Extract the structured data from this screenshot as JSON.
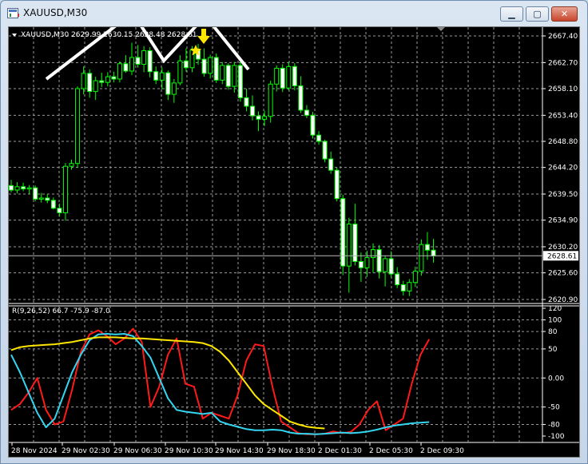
{
  "window": {
    "title": "XAUUSD,M30",
    "min_glyph": "▁",
    "max_glyph": "▢",
    "close_glyph": "✕"
  },
  "price_panel": {
    "info": "XAUUSD,M30  2629.99 2630.15 2628.48 2628.61",
    "current_price": "2628.61",
    "y_ticks": [
      "2667.40",
      "2662.70",
      "2658.10",
      "2653.40",
      "2648.80",
      "2644.20",
      "2639.50",
      "2634.90",
      "2630.20",
      "2625.60",
      "2620.90"
    ]
  },
  "indicator_panel": {
    "label": "R(9,26,52) 66.7 -75.9 -87.0",
    "y_ticks": [
      "120",
      "100",
      "80",
      "50",
      "0.00",
      "-50",
      "-80",
      "-100"
    ]
  },
  "x_axis": {
    "labels": [
      "28 Nov 2024",
      "29 Nov 02:30",
      "29 Nov 06:30",
      "29 Nov 10:30",
      "29 Nov 14:30",
      "29 Nov 18:30",
      "2 Dec 01:30",
      "2 Dec 05:30",
      "2 Dec 09:30"
    ]
  },
  "colors": {
    "background": "#000000",
    "grid": "#9a9a9a",
    "candle": "#00ff00",
    "bull_body": "#000000",
    "bear_body": "#ffffff",
    "red_line": "#ff1a1a",
    "cyan_line": "#33d6f0",
    "yellow_line": "#ffe600",
    "pattern_line": "#ffffff",
    "arrow": "#ffe600"
  },
  "chart_data": [
    {
      "type": "candlestick",
      "symbol": "XAUUSD",
      "timeframe": "M30",
      "ylim": [
        2620.9,
        2667.4
      ],
      "ohlc": [
        [
          2641.0,
          2642.0,
          2639.8,
          2640.2
        ],
        [
          2640.2,
          2641.6,
          2639.6,
          2640.8
        ],
        [
          2640.8,
          2641.5,
          2640.0,
          2640.4
        ],
        [
          2640.4,
          2641.1,
          2639.5,
          2640.6
        ],
        [
          2640.6,
          2641.0,
          2638.2,
          2638.6
        ],
        [
          2638.6,
          2639.7,
          2638.0,
          2638.8
        ],
        [
          2638.8,
          2639.5,
          2637.9,
          2638.4
        ],
        [
          2638.4,
          2638.9,
          2636.8,
          2637.0
        ],
        [
          2637.0,
          2637.8,
          2635.5,
          2636.2
        ],
        [
          2636.2,
          2645.0,
          2634.8,
          2644.4
        ],
        [
          2644.4,
          2645.6,
          2643.8,
          2644.9
        ],
        [
          2644.9,
          2658.5,
          2644.2,
          2658.1
        ],
        [
          2658.1,
          2662.0,
          2657.1,
          2660.8
        ],
        [
          2660.8,
          2661.5,
          2656.5,
          2657.6
        ],
        [
          2657.6,
          2660.2,
          2656.1,
          2659.5
        ],
        [
          2659.5,
          2660.9,
          2658.4,
          2659.2
        ],
        [
          2659.2,
          2661.0,
          2658.5,
          2660.2
        ],
        [
          2660.2,
          2661.1,
          2659.2,
          2659.8
        ],
        [
          2659.8,
          2662.9,
          2659.2,
          2662.5
        ],
        [
          2662.5,
          2664.0,
          2660.9,
          2661.2
        ],
        [
          2661.2,
          2666.2,
          2660.5,
          2663.6
        ],
        [
          2663.6,
          2665.8,
          2661.8,
          2662.4
        ],
        [
          2662.4,
          2665.6,
          2661.0,
          2664.8
        ],
        [
          2664.8,
          2665.4,
          2660.1,
          2661.1
        ],
        [
          2661.1,
          2662.0,
          2658.9,
          2659.6
        ],
        [
          2659.6,
          2661.8,
          2658.0,
          2660.9
        ],
        [
          2660.9,
          2661.3,
          2656.1,
          2657.1
        ],
        [
          2657.1,
          2659.8,
          2655.6,
          2659.1
        ],
        [
          2659.1,
          2664.0,
          2658.7,
          2663.0
        ],
        [
          2663.0,
          2665.2,
          2661.1,
          2661.8
        ],
        [
          2661.8,
          2665.6,
          2661.0,
          2664.9
        ],
        [
          2664.9,
          2666.0,
          2662.3,
          2663.3
        ],
        [
          2663.3,
          2665.2,
          2660.2,
          2660.8
        ],
        [
          2660.8,
          2664.1,
          2659.9,
          2663.6
        ],
        [
          2663.6,
          2664.3,
          2659.1,
          2659.6
        ],
        [
          2659.6,
          2662.8,
          2658.9,
          2662.2
        ],
        [
          2662.2,
          2662.6,
          2657.9,
          2658.5
        ],
        [
          2658.5,
          2662.8,
          2657.4,
          2662.2
        ],
        [
          2662.2,
          2662.8,
          2655.8,
          2656.5
        ],
        [
          2656.5,
          2658.1,
          2654.1,
          2655.0
        ],
        [
          2655.0,
          2656.9,
          2652.5,
          2653.3
        ],
        [
          2653.3,
          2654.1,
          2650.6,
          2652.7
        ],
        [
          2652.7,
          2654.2,
          2651.5,
          2653.2
        ],
        [
          2653.2,
          2659.5,
          2652.1,
          2658.9
        ],
        [
          2658.9,
          2662.2,
          2657.6,
          2661.7
        ],
        [
          2661.7,
          2662.4,
          2657.5,
          2658.2
        ],
        [
          2658.2,
          2662.8,
          2657.8,
          2662.0
        ],
        [
          2662.0,
          2662.6,
          2657.8,
          2658.6
        ],
        [
          2658.6,
          2660.3,
          2653.8,
          2654.3
        ],
        [
          2654.3,
          2655.2,
          2652.9,
          2653.4
        ],
        [
          2653.4,
          2654.0,
          2649.3,
          2649.9
        ],
        [
          2649.9,
          2650.6,
          2648.2,
          2648.8
        ],
        [
          2648.8,
          2649.1,
          2645.1,
          2645.7
        ],
        [
          2645.7,
          2647.0,
          2643.1,
          2643.7
        ],
        [
          2643.7,
          2644.2,
          2638.2,
          2638.7
        ],
        [
          2638.7,
          2639.4,
          2625.2,
          2626.8
        ],
        [
          2626.8,
          2635.3,
          2622.1,
          2634.2
        ],
        [
          2634.2,
          2637.8,
          2626.9,
          2627.6
        ],
        [
          2627.6,
          2629.2,
          2624.0,
          2626.5
        ],
        [
          2626.5,
          2629.5,
          2624.9,
          2628.3
        ],
        [
          2628.3,
          2630.8,
          2625.6,
          2629.7
        ],
        [
          2629.7,
          2630.5,
          2624.6,
          2625.8
        ],
        [
          2625.8,
          2628.6,
          2623.2,
          2628.1
        ],
        [
          2628.1,
          2629.4,
          2624.8,
          2625.4
        ],
        [
          2625.4,
          2626.6,
          2622.9,
          2623.5
        ],
        [
          2623.5,
          2624.2,
          2621.6,
          2622.4
        ],
        [
          2622.4,
          2624.5,
          2621.5,
          2623.9
        ],
        [
          2623.9,
          2626.7,
          2623.1,
          2625.9
        ],
        [
          2625.9,
          2631.5,
          2625.1,
          2630.6
        ],
        [
          2630.6,
          2632.8,
          2627.9,
          2629.6
        ],
        [
          2629.6,
          2631.6,
          2627.4,
          2628.6
        ]
      ]
    },
    {
      "type": "line",
      "title": "R(9,26,52)",
      "ylim": [
        -100,
        120
      ],
      "series": [
        {
          "name": "R9",
          "color": "#ff1a1a",
          "values": [
            -55,
            -45,
            -25,
            0,
            -55,
            -80,
            -75,
            -20,
            45,
            75,
            82,
            72,
            58,
            68,
            85,
            62,
            -50,
            -15,
            40,
            68,
            -10,
            -15,
            -70,
            -60,
            -65,
            -70,
            -30,
            30,
            58,
            55,
            -15,
            -75,
            -85,
            -95,
            -97,
            -97,
            -96,
            -92,
            -95,
            -93,
            -80,
            -55,
            -40,
            -90,
            -80,
            -70,
            -10,
            40,
            66.7
          ]
        },
        {
          "name": "R26",
          "color": "#33d6f0",
          "values": [
            40,
            10,
            -25,
            -60,
            -85,
            -70,
            -30,
            10,
            40,
            65,
            75,
            76,
            75,
            76,
            72,
            55,
            35,
            0,
            -35,
            -55,
            -58,
            -60,
            -62,
            -60,
            -75,
            -80,
            -84,
            -88,
            -90,
            -90,
            -89,
            -90,
            -94,
            -96,
            -96,
            -97,
            -96,
            -95,
            -94,
            -95,
            -94,
            -92,
            -89,
            -85,
            -82,
            -80,
            -78,
            -77,
            -75.9
          ]
        },
        {
          "name": "R52",
          "color": "#ffe600",
          "values": [
            48,
            53,
            55,
            56,
            57,
            58,
            60,
            62,
            65,
            68,
            70,
            70,
            70,
            69,
            68,
            68,
            67,
            66,
            65,
            64,
            63,
            62,
            60,
            55,
            45,
            30,
            10,
            -10,
            -30,
            -45,
            -55,
            -65,
            -75,
            -80,
            -84,
            -86,
            -87
          ]
        }
      ]
    }
  ]
}
